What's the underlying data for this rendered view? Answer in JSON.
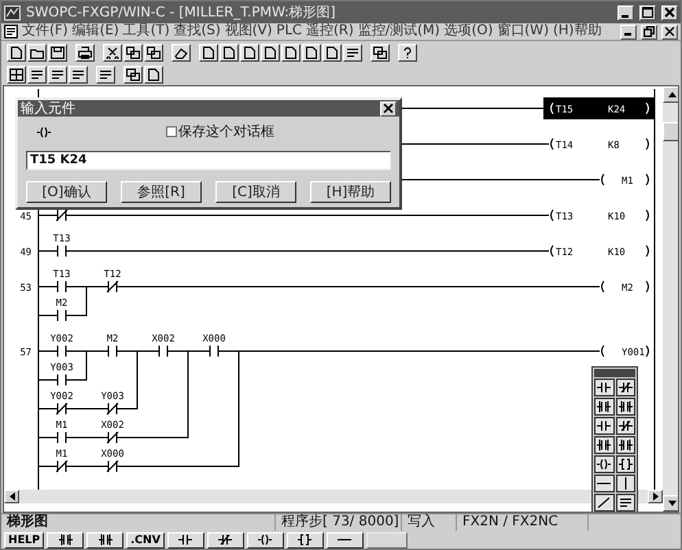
{
  "window": {
    "title": "SWOPC-FXGP/WIN-C - [MILLER_T.PMW:梯形图]"
  },
  "menu": [
    "文件(F)",
    "编辑(E)",
    "工具(T)",
    "查找(S)",
    "视图(V)",
    "PLC",
    "遥控(R)",
    "监控/测试(M)",
    "选项(O)",
    "窗口(W)",
    "(H)帮助"
  ],
  "ladder": {
    "rungs": [
      {
        "coil": {
          "kind": "timer",
          "operand": "T15",
          "setting": "K24"
        },
        "selected": true
      },
      {
        "coil": {
          "kind": "timer",
          "operand": "T14",
          "setting": "K8"
        },
        "selected": false
      },
      {
        "coil": {
          "kind": "output",
          "operand": "M1"
        },
        "selected": false
      },
      {
        "step": "45",
        "contacts": [
          {
            "kind": "nc"
          }
        ],
        "coil": {
          "kind": "timer",
          "operand": "T13",
          "setting": "K10"
        },
        "selected": false
      },
      {
        "step": "49",
        "contacts": [
          {
            "kind": "no",
            "label": "T13"
          }
        ],
        "coil": {
          "kind": "timer",
          "operand": "T12",
          "setting": "K10"
        },
        "selected": false
      },
      {
        "step": "53",
        "contacts": [
          {
            "kind": "no",
            "label": "T13",
            "parallel_branches": [
              {
                "contacts": [
                  {
                    "kind": "no",
                    "label": "M2"
                  }
                ]
              }
            ]
          },
          {
            "kind": "nc",
            "label": "T12"
          }
        ],
        "coil": {
          "kind": "output",
          "operand": "M2"
        },
        "selected": false
      },
      {
        "step": "57",
        "contacts": [
          {
            "kind": "no",
            "label": "Y002",
            "parallel_branches": [
              {
                "contacts": [
                  {
                    "kind": "no",
                    "label": "Y003"
                  }
                ]
              }
            ]
          },
          {
            "kind": "no",
            "label": "M2",
            "parallel_branches": [
              {
                "contacts": [
                  {
                    "kind": "nc",
                    "label": "Y002"
                  },
                  {
                    "kind": "nc",
                    "label": "Y003"
                  }
                ]
              }
            ]
          },
          {
            "kind": "no",
            "label": "X002",
            "parallel_branches": [
              {
                "contacts": [
                  {
                    "kind": "no",
                    "label": "M1"
                  },
                  {
                    "kind": "nc",
                    "label": "X002"
                  }
                ]
              }
            ]
          },
          {
            "kind": "no",
            "label": "X000",
            "parallel_branches": [
              {
                "contacts": [
                  {
                    "kind": "nc",
                    "label": "M1"
                  },
                  {
                    "kind": "nc",
                    "label": "X000"
                  }
                ]
              }
            ]
          }
        ],
        "coil": {
          "kind": "output",
          "operand": "Y001"
        },
        "selected": false
      }
    ]
  },
  "dialog": {
    "title": "输入元件",
    "keep_open": {
      "label": "保存这个对话框",
      "checked": false
    },
    "input": "T15 K24",
    "buttons": [
      "[O]确认",
      "参照[R]",
      "[C]取消",
      "[H]帮助"
    ]
  },
  "status_bar": {
    "mode": "梯形图",
    "steps": "程序步[ 73/ 8000]",
    "action": "写入",
    "plc": "FX2N / FX2NC"
  },
  "function_keys": [
    {
      "kind": "text",
      "label": "HELP"
    },
    {
      "kind": "icon"
    },
    {
      "kind": "icon"
    },
    {
      "kind": "text",
      "label": ".CNV"
    },
    {
      "kind": "icon"
    },
    {
      "kind": "icon"
    },
    {
      "kind": "icon"
    },
    {
      "kind": "icon"
    },
    {
      "kind": "icon"
    },
    {
      "kind": "blank"
    }
  ]
}
